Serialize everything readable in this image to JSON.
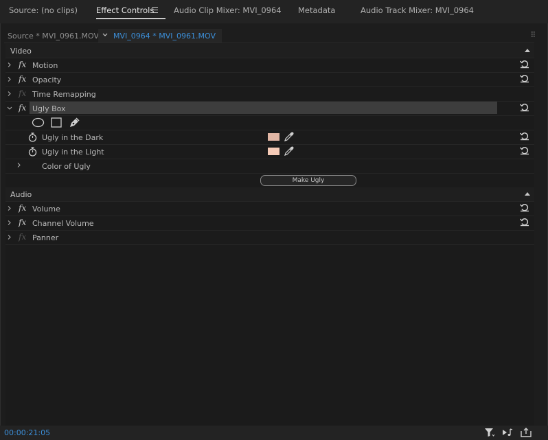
{
  "tabs": [
    {
      "label": "Source: (no clips)",
      "active": false
    },
    {
      "label": "Effect Controls",
      "active": true
    },
    {
      "label": "Audio Clip Mixer: MVI_0964",
      "active": false
    },
    {
      "label": "Metadata",
      "active": false
    },
    {
      "label": "Audio Track Mixer: MVI_0964",
      "active": false
    }
  ],
  "clipbar": {
    "source": "Source * MVI_0961.MOV",
    "sequence": "MVI_0964 * MVI_0961.MOV"
  },
  "video": {
    "label": "Video",
    "effects": {
      "motion": "Motion",
      "opacity": "Opacity",
      "time_remapping": "Time Remapping",
      "ugly_box": "Ugly Box"
    },
    "ugly_box_params": {
      "dark_label": "Ugly in the Dark",
      "dark_color": "#e2b7a5",
      "light_label": "Ugly in the Light",
      "light_color": "#f6cbb7",
      "color_group": "Color of Ugly",
      "button": "Make Ugly"
    }
  },
  "audio": {
    "label": "Audio",
    "effects": {
      "volume": "Volume",
      "channel_volume": "Channel Volume",
      "panner": "Panner"
    }
  },
  "status": {
    "timecode": "00:00:21:05"
  },
  "colors": {
    "accent": "#3c8fd9",
    "panel_bg": "#1d1d1d"
  },
  "icons": {
    "ellipse": "ellipse-mask-icon",
    "rectangle": "rectangle-mask-icon",
    "pen": "pen-mask-icon",
    "stopwatch": "stopwatch-icon",
    "eyedropper": "eyedropper-icon",
    "reset": "reset-parameter-icon",
    "filter": "filter-icon",
    "play_audio": "play-audio-icon",
    "export": "export-icon"
  }
}
